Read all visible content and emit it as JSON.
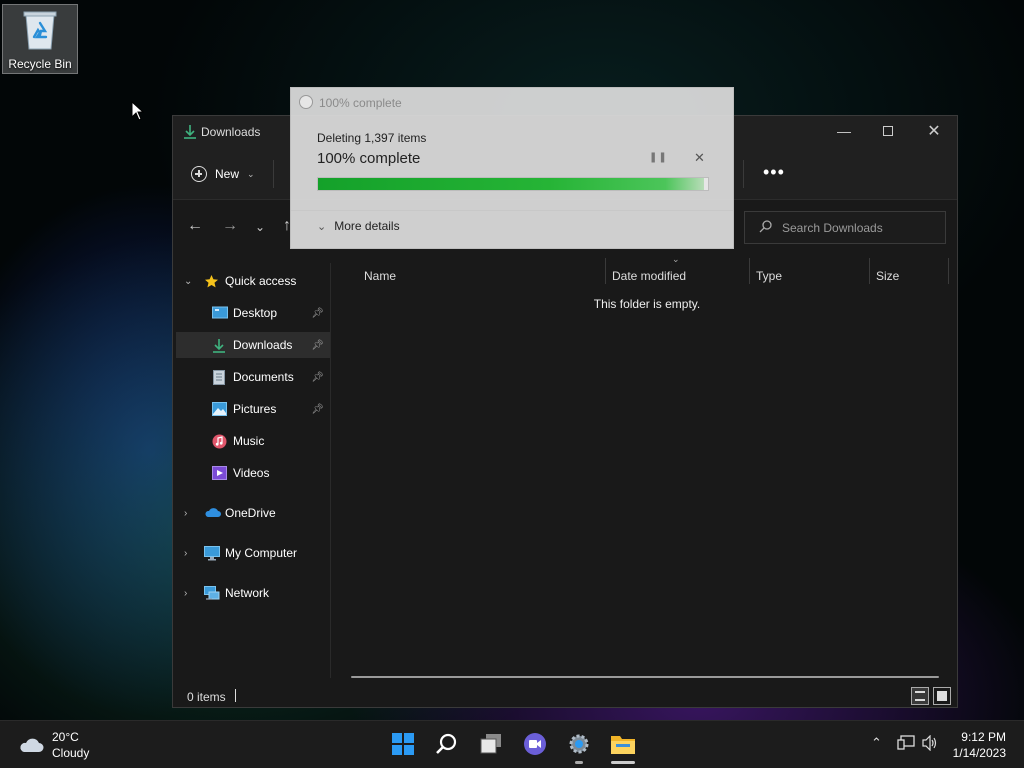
{
  "desktop": {
    "recycle_bin_label": "Recycle Bin"
  },
  "explorer": {
    "title": "Downloads",
    "toolbar": {
      "new_label": "New",
      "more_label": "•••"
    },
    "search": {
      "placeholder": "Search Downloads"
    },
    "sidebar": {
      "quick_access": "Quick access",
      "items": [
        {
          "label": "Desktop",
          "icon": "desktop-icon",
          "pinned": true
        },
        {
          "label": "Downloads",
          "icon": "download-icon",
          "pinned": true,
          "selected": true
        },
        {
          "label": "Documents",
          "icon": "documents-icon",
          "pinned": true
        },
        {
          "label": "Pictures",
          "icon": "pictures-icon",
          "pinned": true
        },
        {
          "label": "Music",
          "icon": "music-icon",
          "pinned": false
        },
        {
          "label": "Videos",
          "icon": "videos-icon",
          "pinned": false
        }
      ],
      "onedrive": "OneDrive",
      "my_computer": "My Computer",
      "network": "Network"
    },
    "columns": {
      "name": "Name",
      "date_modified": "Date modified",
      "type": "Type",
      "size": "Size"
    },
    "empty_message": "This folder is empty.",
    "status": "0 items"
  },
  "progress_dialog": {
    "title": "100% complete",
    "status": "Deleting 1,397 items",
    "percent_text": "100% complete",
    "progress_value": 0.99,
    "more_details": "More details"
  },
  "taskbar": {
    "weather_temp": "20°C",
    "weather_desc": "Cloudy",
    "time": "9:12 PM",
    "date": "1/14/2023"
  },
  "colors": {
    "progress_green": "#14a12a",
    "accent_blue": "#3a9ad9",
    "window_bg": "#191919"
  }
}
